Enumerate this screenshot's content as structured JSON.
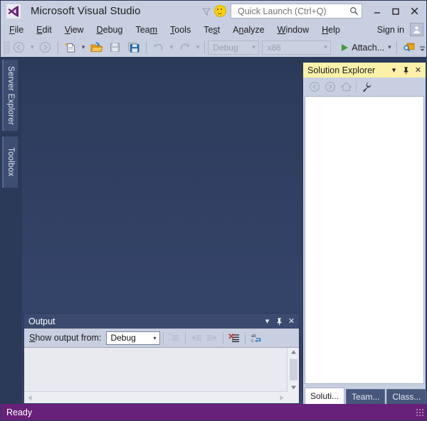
{
  "window": {
    "title": "Microsoft Visual Studio",
    "logo_icon": "visual-studio-logo",
    "feedback_icon": "funnel-icon",
    "smiley_icon": "smiley-feedback-icon",
    "minimize_label": "–",
    "maximize_label": "❑",
    "close_label": "✕"
  },
  "quick_launch": {
    "placeholder": "Quick Launch (Ctrl+Q)",
    "value": "",
    "search_icon": "magnifier-icon"
  },
  "menu": {
    "items": [
      {
        "pre": "",
        "mnemonic": "F",
        "post": "ile"
      },
      {
        "pre": "",
        "mnemonic": "E",
        "post": "dit"
      },
      {
        "pre": "",
        "mnemonic": "V",
        "post": "iew"
      },
      {
        "pre": "",
        "mnemonic": "D",
        "post": "ebug"
      },
      {
        "pre": "Tea",
        "mnemonic": "m",
        "post": ""
      },
      {
        "pre": "",
        "mnemonic": "T",
        "post": "ools"
      },
      {
        "pre": "Te",
        "mnemonic": "s",
        "post": "t"
      },
      {
        "pre": "A",
        "mnemonic": "n",
        "post": "alyze"
      },
      {
        "pre": "",
        "mnemonic": "W",
        "post": "indow"
      },
      {
        "pre": "",
        "mnemonic": "H",
        "post": "elp"
      }
    ],
    "sign_in_label": "Sign in",
    "avatar_icon": "user-avatar-icon"
  },
  "toolbar": {
    "grip_name": "toolbar-grip",
    "navigate_back_icon": "navigate-back-icon",
    "navigate_back_dropdown": "▾",
    "navigate_forward_icon": "navigate-forward-icon",
    "new_project_icon": "new-project-icon",
    "new_project_dropdown": "▾",
    "open_file_icon": "open-file-icon",
    "save_icon": "save-icon",
    "save_all_icon": "save-all-icon",
    "undo_icon": "undo-icon",
    "undo_dropdown": "▾",
    "redo_icon": "redo-icon",
    "redo_dropdown": "▾",
    "config_value": "Debug",
    "platform_value": "x86",
    "dropdown_glyph": "▾",
    "attach_label": "Attach...",
    "attach_dropdown": "▾",
    "find_window_icon": "find-in-window-icon",
    "overflow_icon": "toolbar-overflow-icon"
  },
  "sidebar_tabs": {
    "server_explorer": "Server Explorer",
    "toolbox": "Toolbox"
  },
  "output_panel": {
    "title": "Output",
    "dropdown_glyph": "▾",
    "pin_glyph": "╤",
    "close_glyph": "✕",
    "show_output_from_pre": "",
    "show_output_from_mnemonic": "S",
    "show_output_from_post": "how output from:",
    "source_value": "Debug",
    "source_arrow": "▾",
    "icons": [
      "find-message-icon",
      "go-to-previous-message-icon",
      "go-to-next-message-icon",
      "clear-all-icon",
      "toggle-word-wrap-icon"
    ],
    "scroll_up_glyph": "▲",
    "scroll_down_glyph": "▼",
    "scroll_left_glyph": "◀",
    "scroll_right_glyph": "▶",
    "content": ""
  },
  "solution_explorer": {
    "title": "Solution Explorer",
    "dropdown_glyph": "▾",
    "pin_glyph": "╤",
    "close_glyph": "✕",
    "toolbar_icons": [
      "back-arrow-icon",
      "forward-arrow-icon",
      "home-icon",
      "properties-wrench-icon"
    ],
    "tree_content": "",
    "tabs": [
      {
        "label": "Soluti...",
        "active": true
      },
      {
        "label": "Team...",
        "active": false
      },
      {
        "label": "Class...",
        "active": false
      }
    ]
  },
  "status_bar": {
    "text": "Ready",
    "grip_name": "resize-grip"
  },
  "colors": {
    "title_bar": "#c7cfe0",
    "workspace": "#2c3a5a",
    "status_bar": "#68217a",
    "solution_title_active": "#fcf1a8",
    "output_title": "#3b4a6e",
    "accent_purple": "#68217a",
    "play_green": "#3f9b35"
  }
}
